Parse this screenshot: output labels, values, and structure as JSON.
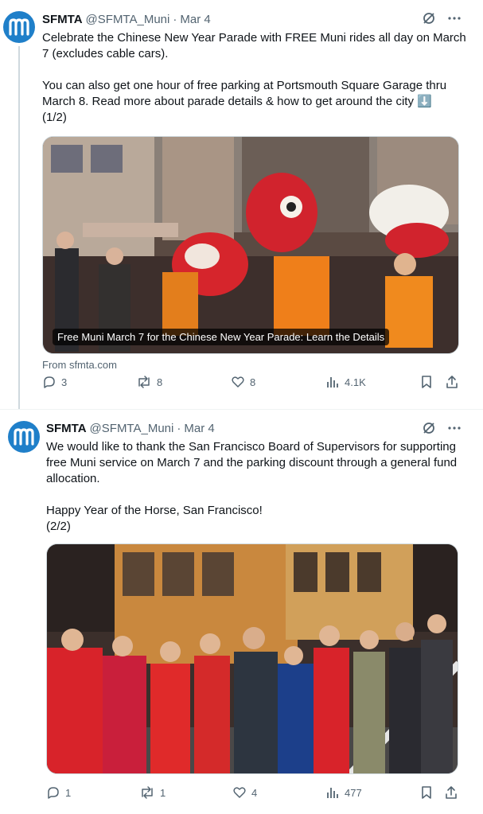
{
  "colors": {
    "brand_blue": "#1f7fc9",
    "text_primary": "#0f1419",
    "text_secondary": "#536471",
    "border": "#cfd9de"
  },
  "tweets": [
    {
      "author": {
        "name": "SFMTA",
        "handle": "@SFMTA_Muni",
        "separator": "·",
        "date": "Mar 4"
      },
      "text": "Celebrate the Chinese New Year Parade with FREE Muni rides all day on March 7 (excludes cable cars).\n\nYou can also get one hour of free parking at Portsmouth Square Garage thru March 8. Read more about parade details & how to get around the city ⬇️\n(1/2)",
      "card": {
        "caption": "Free Muni March 7 for the Chinese New Year Parade: Learn the Details",
        "source": "From sfmta.com"
      },
      "stats": {
        "replies": "3",
        "reposts": "8",
        "likes": "8",
        "views": "4.1K"
      }
    },
    {
      "author": {
        "name": "SFMTA",
        "handle": "@SFMTA_Muni",
        "separator": "·",
        "date": "Mar 4"
      },
      "text": "We would like to thank the San Francisco Board of Supervisors for supporting free Muni service on March 7 and the parking discount through a general fund allocation.\n\nHappy Year of the Horse, San Francisco!\n(2/2)",
      "stats": {
        "replies": "1",
        "reposts": "1",
        "likes": "4",
        "views": "477"
      }
    }
  ],
  "icons": {
    "avatar": "muni-logo-icon",
    "grok": "grok-icon",
    "more": "more-icon",
    "reply": "reply-icon",
    "repost": "repost-icon",
    "like": "heart-icon",
    "views": "views-icon",
    "bookmark": "bookmark-icon",
    "share": "share-icon"
  }
}
